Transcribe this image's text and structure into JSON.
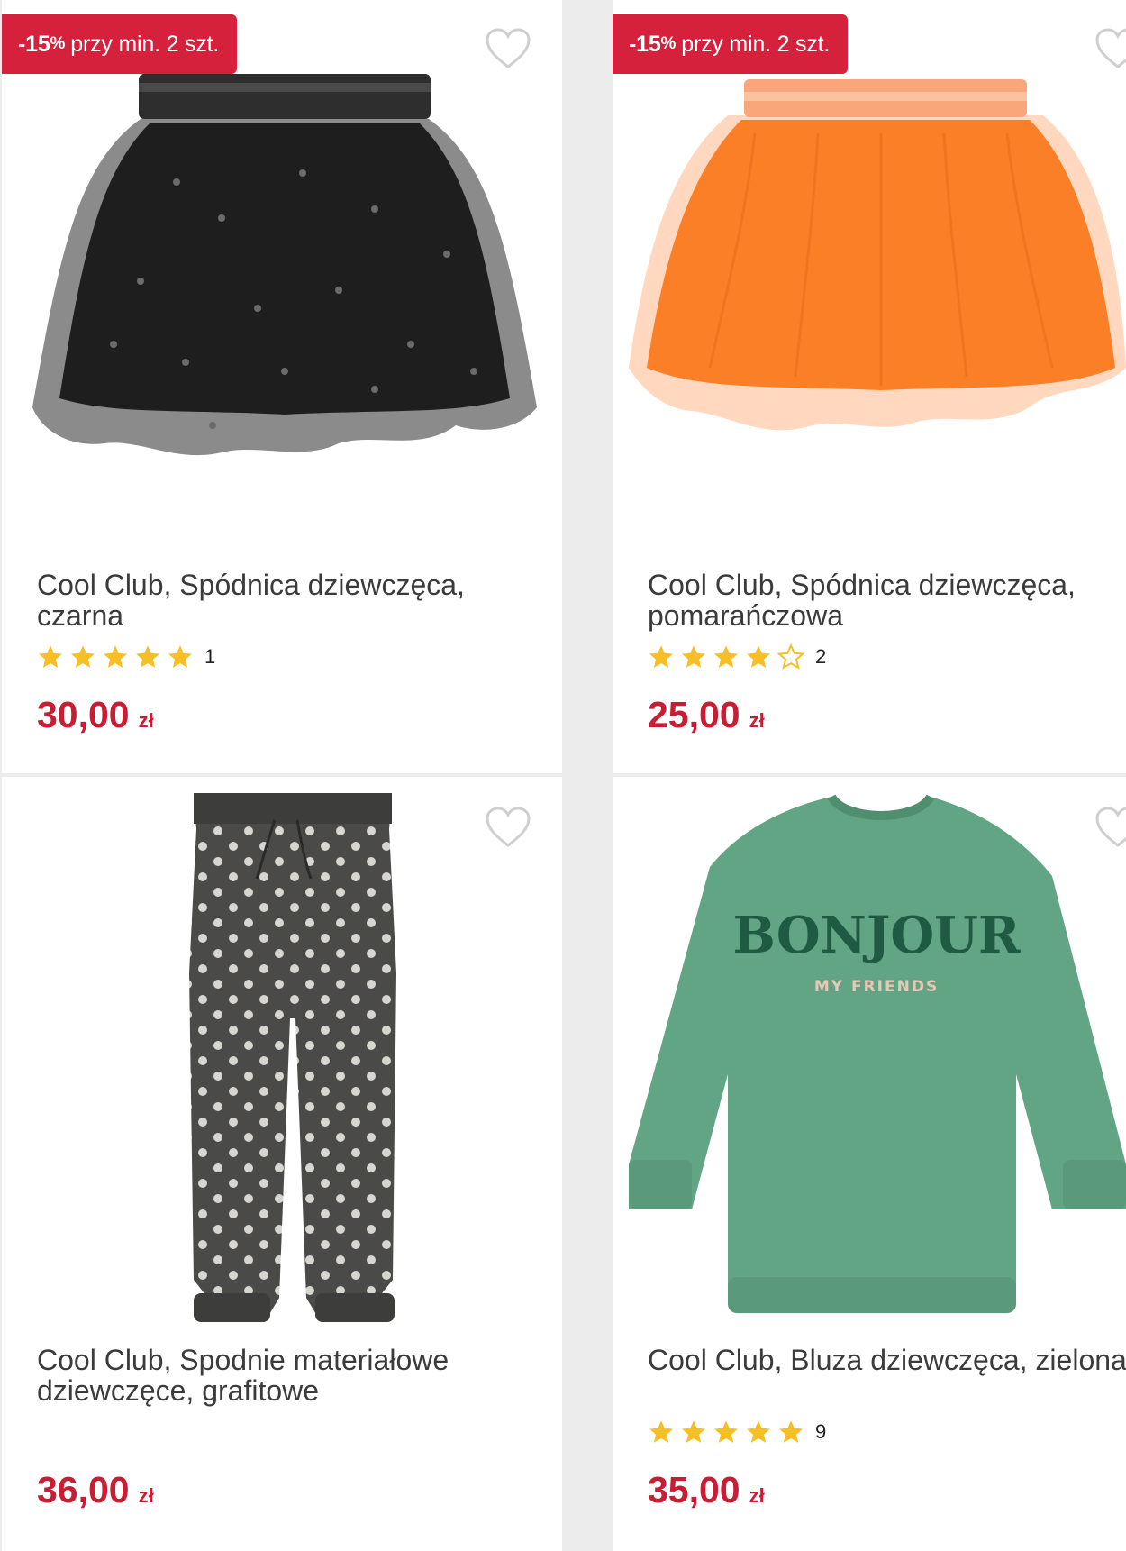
{
  "products": [
    {
      "badge": {
        "pct": "-15",
        "pct_sign": "%",
        "text": "przy min. 2 szt."
      },
      "title": "Cool Club, Spódnica dziewczęca, czarna",
      "rating": {
        "stars": 5,
        "count": "1"
      },
      "price": {
        "amount": "30,00",
        "currency": "zł"
      },
      "image": "black-star-tulle-skirt"
    },
    {
      "badge": {
        "pct": "-15",
        "pct_sign": "%",
        "text": "przy min. 2 szt."
      },
      "title": "Cool Club, Spódnica dziewczęca, pomarańczowa",
      "rating": {
        "stars": 4,
        "count": "2"
      },
      "price": {
        "amount": "25,00",
        "currency": "zł"
      },
      "image": "orange-tulle-skirt"
    },
    {
      "title": "Cool Club, Spodnie materiałowe dziewczęce, grafitowe",
      "price": {
        "amount": "36,00",
        "currency": "zł"
      },
      "image": "graphite-polka-dot-trousers"
    },
    {
      "title": "Cool Club, Bluza dziewczęca, zielona",
      "rating": {
        "stars": 5,
        "count": "9"
      },
      "price": {
        "amount": "35,00",
        "currency": "zł"
      },
      "image": "green-bonjour-sweatshirt",
      "print": {
        "line1": "BONJOUR",
        "line2": "MY FRIENDS"
      }
    }
  ],
  "colors": {
    "accent": "#c81e35",
    "badge": "#d5213c",
    "star": "#f6bf26"
  }
}
